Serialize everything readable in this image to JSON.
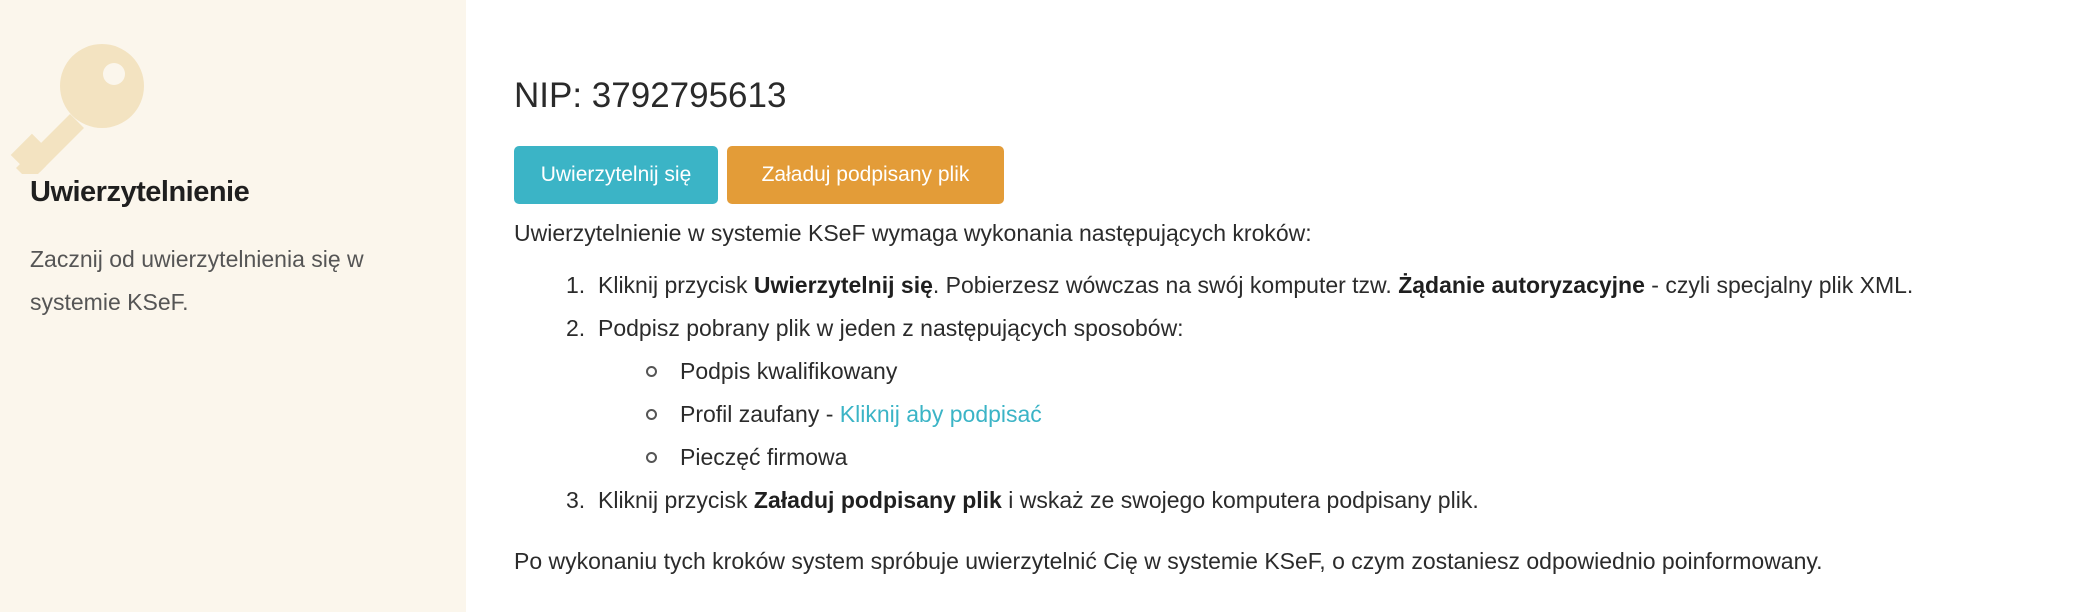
{
  "sidebar": {
    "title": "Uwierzytelnienie",
    "description": "Zacznij od uwierzytelnienia się w systemie KSeF.",
    "icon": "key-icon",
    "background": "#fbf6ec"
  },
  "main": {
    "nip": "NIP: 3792795613",
    "buttons": {
      "authenticate_label": "Uwierzytelnij się",
      "upload_label": "Załaduj podpisany plik",
      "authenticate_color": "#3bb4c6",
      "upload_color": "#e39c38"
    },
    "intro": "Uwierzytelnienie w systemie KSeF wymaga wykonania następujących kroków:",
    "steps": [
      {
        "num": "1.",
        "pre": "Kliknij przycisk ",
        "bold1": "Uwierzytelnij się",
        "mid": ". Pobierzesz wówczas na swój komputer tzw. ",
        "bold2": "Żądanie autoryzacyjne",
        "post": " - czyli specjalny plik XML."
      },
      {
        "num": "2.",
        "text": "Podpisz pobrany plik w jeden z następujących sposobów:",
        "sub": [
          {
            "text": "Podpis kwalifikowany"
          },
          {
            "text": "Profil zaufany - ",
            "link": "Kliknij aby podpisać"
          },
          {
            "text": "Pieczęć firmowa"
          }
        ]
      },
      {
        "num": "3.",
        "pre": "Kliknij przycisk ",
        "bold1": "Załaduj podpisany plik",
        "post": " i wskaż ze swojego komputera podpisany plik."
      }
    ],
    "outro": "Po wykonaniu tych kroków system spróbuje uwierzytelnić Cię w systemie KSeF, o czym zostaniesz odpowiednio poinformowany."
  }
}
